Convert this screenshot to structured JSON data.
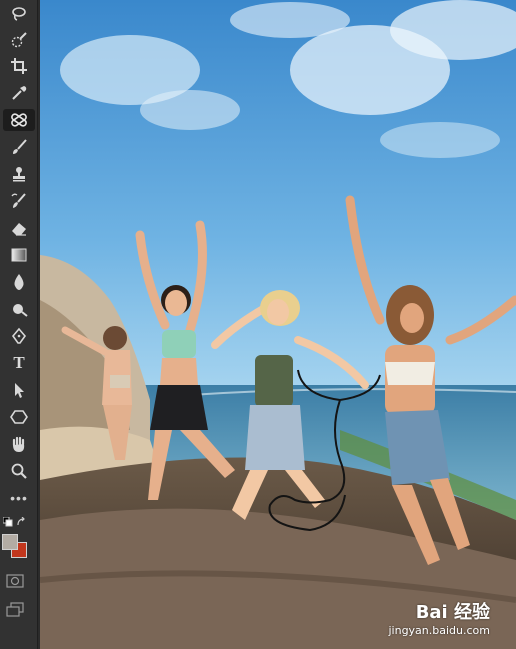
{
  "toolbar": {
    "tools": [
      {
        "name": "lasso-tool",
        "icon": "lasso-icon"
      },
      {
        "name": "quick-selection-tool",
        "icon": "quick-selection-icon"
      },
      {
        "name": "crop-tool",
        "icon": "crop-icon"
      },
      {
        "name": "eyedropper-tool",
        "icon": "eyedropper-icon"
      },
      {
        "name": "healing-brush-tool",
        "icon": "bandage-icon",
        "active": true
      },
      {
        "name": "brush-tool",
        "icon": "brush-icon"
      },
      {
        "name": "clone-stamp-tool",
        "icon": "stamp-icon"
      },
      {
        "name": "history-brush-tool",
        "icon": "history-brush-icon"
      },
      {
        "name": "eraser-tool",
        "icon": "eraser-icon"
      },
      {
        "name": "gradient-tool",
        "icon": "gradient-icon"
      },
      {
        "name": "blur-tool",
        "icon": "droplet-icon"
      },
      {
        "name": "dodge-tool",
        "icon": "dodge-icon"
      },
      {
        "name": "pen-tool",
        "icon": "pen-icon"
      },
      {
        "name": "type-tool",
        "icon": "type-icon",
        "label": "T"
      },
      {
        "name": "path-selection-tool",
        "icon": "arrow-icon"
      },
      {
        "name": "shape-tool",
        "icon": "hexagon-icon"
      },
      {
        "name": "hand-tool",
        "icon": "hand-icon"
      },
      {
        "name": "zoom-tool",
        "icon": "magnifier-icon"
      },
      {
        "name": "more-tools",
        "icon": "ellipsis-icon",
        "label": "•••"
      }
    ],
    "foreground_color": "#b3aca4",
    "background_color": "#c2371d"
  },
  "watermark": {
    "logo": "Bai 经验",
    "url": "jingyan.baidu.com"
  },
  "colors": {
    "panel": "#323232",
    "sky_top": "#3f8fd0",
    "sky_bottom": "#8ec6ea",
    "sea": "#3f7fa8"
  }
}
